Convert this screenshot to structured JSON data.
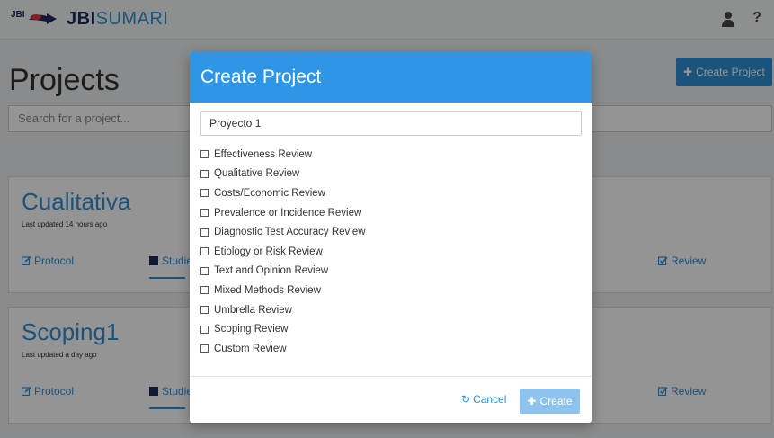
{
  "header": {
    "logo_small": "JBI",
    "brand_part1": "JBI",
    "brand_part2": "SUMARI",
    "help": "?"
  },
  "page": {
    "title": "Projects",
    "create_button": "Create Project",
    "search_placeholder": "Search for a project..."
  },
  "projects": [
    {
      "title": "Cualitativa",
      "updated": "Last updated 14 hours ago",
      "tab_protocol": "Protocol",
      "tab_studies": "Studie",
      "tab_review": "Review"
    },
    {
      "title": "Scoping1",
      "updated": "Last updated a day ago",
      "tab_protocol": "Protocol",
      "tab_studies": "Studie",
      "tab_review": "Review"
    }
  ],
  "modal": {
    "title": "Create Project",
    "name_value": "Proyecto 1",
    "options": [
      "Effectiveness Review",
      "Qualitative Review",
      "Costs/Economic Review",
      "Prevalence or Incidence Review",
      "Diagnostic Test Accuracy Review",
      "Etiology or Risk Review",
      "Text and Opinion Review",
      "Mixed Methods Review",
      "Umbrella Review",
      "Scoping Review",
      "Custom Review"
    ],
    "cancel_label": "Cancel",
    "create_label": "Create"
  }
}
